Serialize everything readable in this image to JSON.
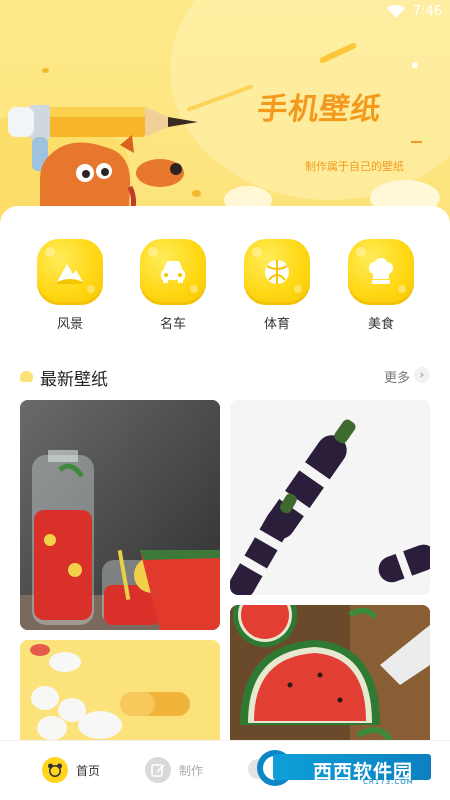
{
  "status": {
    "time": "7:46"
  },
  "banner": {
    "title": "手机壁纸",
    "subtitle": "制作属于自己的壁纸"
  },
  "categories": [
    {
      "label": "风景",
      "icon": "mountain-icon"
    },
    {
      "label": "名车",
      "icon": "car-icon"
    },
    {
      "label": "体育",
      "icon": "ball-icon"
    },
    {
      "label": "美食",
      "icon": "chef-hat-icon"
    }
  ],
  "section": {
    "title": "最新壁纸",
    "more": "更多"
  },
  "wallpapers": [
    {
      "subject": "watermelon drinks"
    },
    {
      "subject": "eggplants"
    },
    {
      "subject": "pills"
    },
    {
      "subject": "watermelon slices"
    }
  ],
  "nav": {
    "home": "首页",
    "make": "制作"
  },
  "watermark": {
    "text": "西西软件园",
    "sub": "CR173.COM"
  },
  "colors": {
    "accent": "#ffd51e",
    "banner": "#fde27a",
    "title": "#f39a1e"
  }
}
